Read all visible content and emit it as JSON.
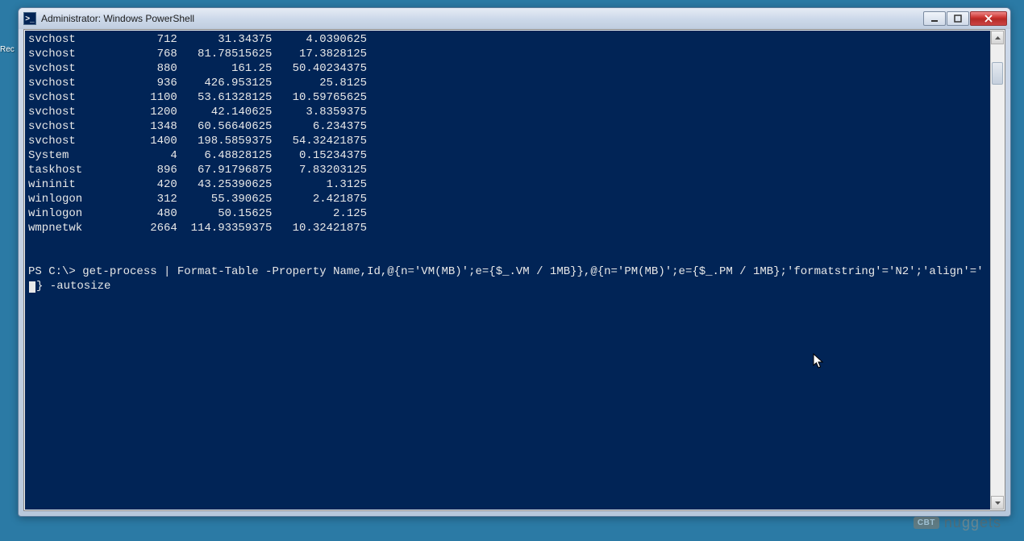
{
  "desktop": {
    "recycle_label": "Rec"
  },
  "window": {
    "title": "Administrator: Windows PowerShell",
    "icon_glyph": ">_"
  },
  "console": {
    "rows": [
      {
        "name": "svchost",
        "id": "712",
        "vm": "31.34375",
        "pm": "4.0390625"
      },
      {
        "name": "svchost",
        "id": "768",
        "vm": "81.78515625",
        "pm": "17.3828125"
      },
      {
        "name": "svchost",
        "id": "880",
        "vm": "161.25",
        "pm": "50.40234375"
      },
      {
        "name": "svchost",
        "id": "936",
        "vm": "426.953125",
        "pm": "25.8125"
      },
      {
        "name": "svchost",
        "id": "1100",
        "vm": "53.61328125",
        "pm": "10.59765625"
      },
      {
        "name": "svchost",
        "id": "1200",
        "vm": "42.140625",
        "pm": "3.8359375"
      },
      {
        "name": "svchost",
        "id": "1348",
        "vm": "60.56640625",
        "pm": "6.234375"
      },
      {
        "name": "svchost",
        "id": "1400",
        "vm": "198.5859375",
        "pm": "54.32421875"
      },
      {
        "name": "System",
        "id": "4",
        "vm": "6.48828125",
        "pm": "0.15234375"
      },
      {
        "name": "taskhost",
        "id": "896",
        "vm": "67.91796875",
        "pm": "7.83203125"
      },
      {
        "name": "wininit",
        "id": "420",
        "vm": "43.25390625",
        "pm": "1.3125"
      },
      {
        "name": "winlogon",
        "id": "312",
        "vm": "55.390625",
        "pm": "2.421875"
      },
      {
        "name": "winlogon",
        "id": "480",
        "vm": "50.15625",
        "pm": "2.125"
      },
      {
        "name": "wmpnetwk",
        "id": "2664",
        "vm": "114.93359375",
        "pm": "10.32421875"
      }
    ],
    "prompt_prefix": "PS C:\\> ",
    "command_part1": "get-process | Format-Table -Property Name,Id,@{n='VM(MB)';e={$_.VM / 1MB}},@{n='PM(MB)';e={$_.PM / 1MB};'formatstring'='N2';'align'='",
    "command_part2": "} -autosize"
  },
  "watermark": {
    "badge": "CBT",
    "text_a": "nu",
    "text_b": "ets"
  }
}
